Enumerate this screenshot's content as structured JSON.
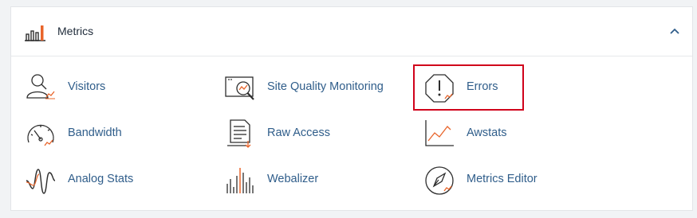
{
  "section": {
    "title": "Metrics",
    "icon": "bar-chart-icon",
    "collapse_icon": "chevron-up-icon"
  },
  "items": [
    {
      "label": "Visitors",
      "icon": "visitors-icon"
    },
    {
      "label": "Site Quality Monitoring",
      "icon": "site-quality-icon"
    },
    {
      "label": "Errors",
      "icon": "errors-icon",
      "highlighted": true
    },
    {
      "label": "Bandwidth",
      "icon": "bandwidth-icon"
    },
    {
      "label": "Raw Access",
      "icon": "raw-access-icon"
    },
    {
      "label": "Awstats",
      "icon": "awstats-icon"
    },
    {
      "label": "Analog Stats",
      "icon": "analog-stats-icon"
    },
    {
      "label": "Webalizer",
      "icon": "webalizer-icon"
    },
    {
      "label": "Metrics Editor",
      "icon": "metrics-editor-icon"
    }
  ],
  "colors": {
    "accent": "#e8642a",
    "icon_stroke": "#2d2d2d",
    "link": "#2f5d8a",
    "highlight": "#d0021b"
  }
}
